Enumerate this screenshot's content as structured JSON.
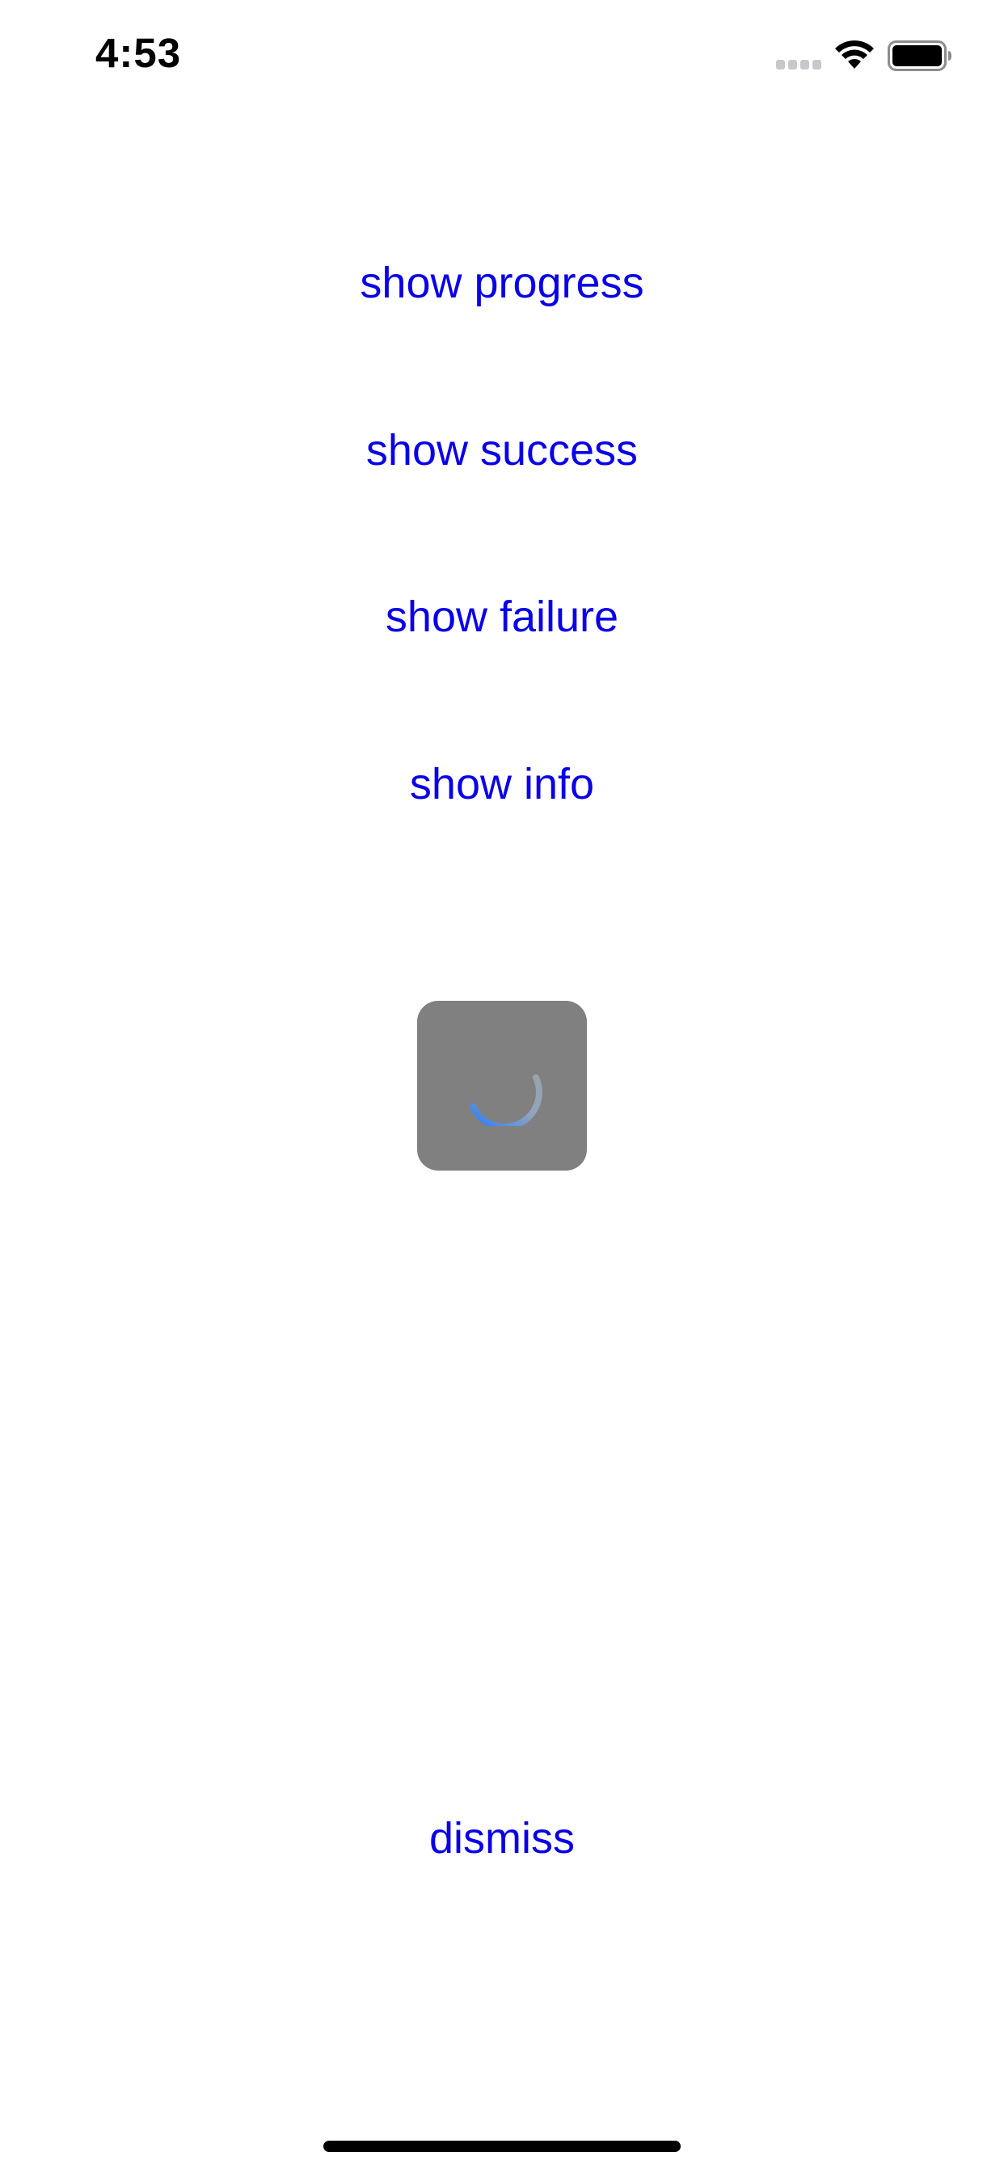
{
  "status_bar": {
    "time": "4:53",
    "icons": [
      "cellular-signal-icon",
      "wifi-icon",
      "battery-icon"
    ]
  },
  "menu": {
    "show_progress": "show progress",
    "show_success": "show success",
    "show_failure": "show failure",
    "show_info": "show info",
    "dismiss": "dismiss"
  },
  "hud": {
    "type": "progress-spinner",
    "icon": "spinner-icon"
  },
  "colors": {
    "link": "#0a00e8",
    "hud_background": "#808080",
    "spinner_accent": "#2a7cf6"
  }
}
